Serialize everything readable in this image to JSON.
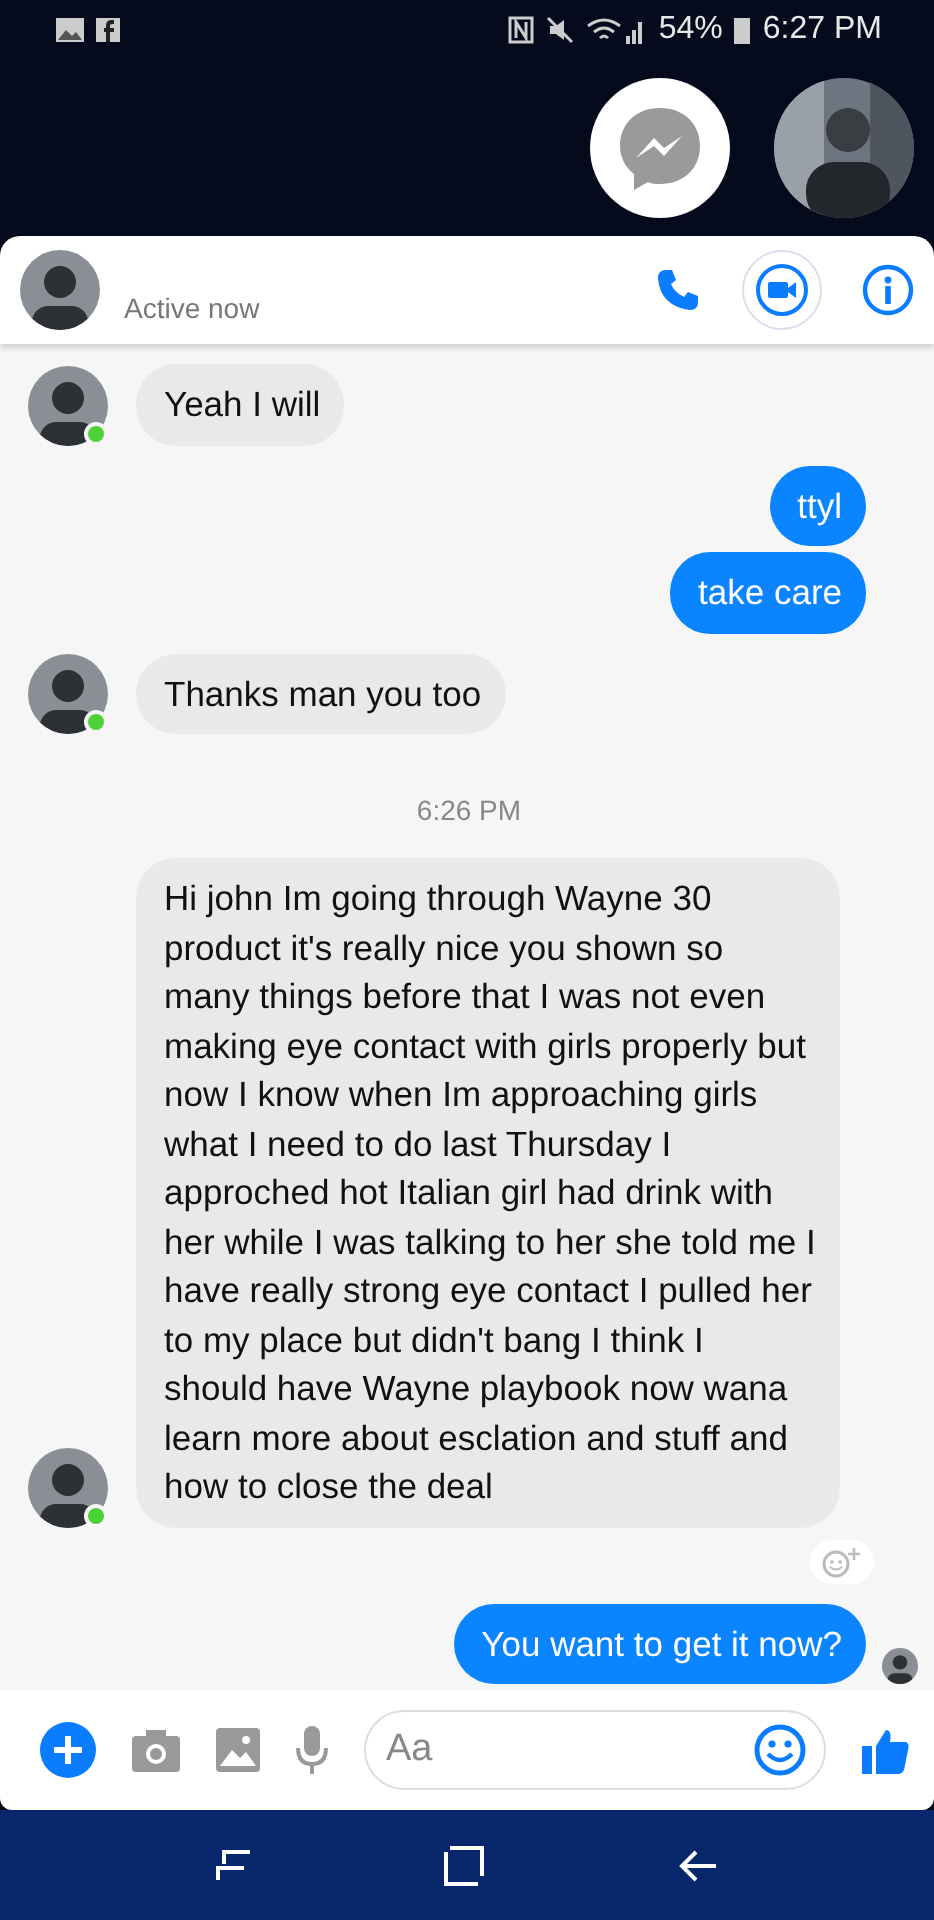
{
  "status_bar": {
    "battery": "54%",
    "time": "6:27 PM"
  },
  "chat_header": {
    "status": "Active now"
  },
  "messages": [
    {
      "kind": "cut"
    },
    {
      "kind": "incoming",
      "text": "Yeah I will",
      "online": true
    },
    {
      "kind": "outgoing",
      "text": "ttyl",
      "seen": false
    },
    {
      "kind": "outgoing",
      "text": "take care",
      "seen": false
    },
    {
      "kind": "incoming",
      "text": "Thanks man you too",
      "online": true
    },
    {
      "kind": "time",
      "text": "6:26 PM"
    },
    {
      "kind": "incoming",
      "text": "Hi john Im going through Wayne 30 product it's really nice you shown so many things before that I was not even making eye contact with girls properly but now I know when Im approaching girls what I need to do last Thursday I approched hot Italian girl had drink with her while I was talking to her she told me I have really strong eye contact I pulled her to my place but didn't bang I think I should have Wayne playbook now wana learn more about esclation and stuff and how to close the deal",
      "online": true,
      "reaction_button": true
    },
    {
      "kind": "outgoing",
      "text": "You want to get it now?",
      "seen": true
    }
  ],
  "composer": {
    "placeholder": "Aa"
  }
}
